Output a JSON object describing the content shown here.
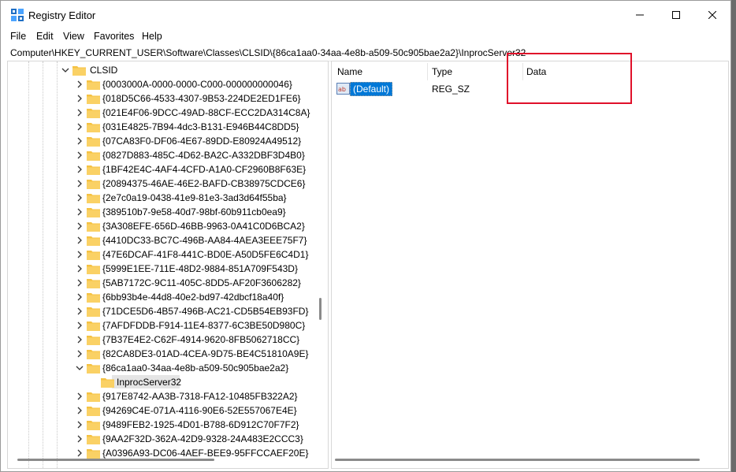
{
  "window": {
    "title": "Registry Editor",
    "controls": [
      "minimize",
      "maximize",
      "close"
    ]
  },
  "menu": [
    "File",
    "Edit",
    "View",
    "Favorites",
    "Help"
  ],
  "address": "Computer\\HKEY_CURRENT_USER\\Software\\Classes\\CLSID\\{86ca1aa0-34aa-4e8b-a509-50c905bae2a2}\\InprocServer32",
  "tree": {
    "parent": "CLSID",
    "keys": [
      "{0003000A-0000-0000-C000-000000000046}",
      "{018D5C66-4533-4307-9B53-224DE2ED1FE6}",
      "{021E4F06-9DCC-49AD-88CF-ECC2DA314C8A}",
      "{031E4825-7B94-4dc3-B131-E946B44C8DD5}",
      "{07CA83F0-DF06-4E67-89DD-E80924A49512}",
      "{0827D883-485C-4D62-BA2C-A332DBF3D4B0}",
      "{1BF42E4C-4AF4-4CFD-A1A0-CF2960B8F63E}",
      "{20894375-46AE-46E2-BAFD-CB38975CDCE6}",
      "{2e7c0a19-0438-41e9-81e3-3ad3d64f55ba}",
      "{389510b7-9e58-40d7-98bf-60b911cb0ea9}",
      "{3A308EFE-656D-46BB-9963-0A41C0D6BCA2}",
      "{4410DC33-BC7C-496B-AA84-4AEA3EEE75F7}",
      "{47E6DCAF-41F8-441C-BD0E-A50D5FE6C4D1}",
      "{5999E1EE-711E-48D2-9884-851A709F543D}",
      "{5AB7172C-9C11-405C-8DD5-AF20F3606282}",
      "{6bb93b4e-44d8-40e2-bd97-42dbcf18a40f}",
      "{71DCE5D6-4B57-496B-AC21-CD5B54EB93FD}",
      "{7AFDFDDB-F914-11E4-8377-6C3BE50D980C}",
      "{7B37E4E2-C62F-4914-9620-8FB5062718CC}",
      "{82CA8DE3-01AD-4CEA-9D75-BE4C51810A9E}",
      "{86ca1aa0-34aa-4e8b-a509-50c905bae2a2}",
      "InprocServer32",
      "{917E8742-AA3B-7318-FA12-10485FB322A2}",
      "{94269C4E-071A-4116-90E6-52E557067E4E}",
      "{9489FEB2-1925-4D01-B788-6D912C70F7F2}",
      "{9AA2F32D-362A-42D9-9328-24A483E2CCC3}",
      "{A0396A93-DC06-4AEF-BEE9-95FFCCAEF20E}"
    ],
    "expanded_key": "{86ca1aa0-34aa-4e8b-a509-50c905bae2a2}",
    "selected_key": "InprocServer32"
  },
  "values_pane": {
    "columns": [
      "Name",
      "Type",
      "Data"
    ],
    "rows": [
      {
        "name": "(Default)",
        "type": "REG_SZ",
        "data": ""
      }
    ]
  },
  "colors": {
    "selection": "#0078d7",
    "folder": "#f5c242",
    "highlight_box": "#e0102a"
  },
  "icons": {
    "app": "registry-icon",
    "tree_folder": "folder-icon",
    "value": "string-value-icon"
  }
}
